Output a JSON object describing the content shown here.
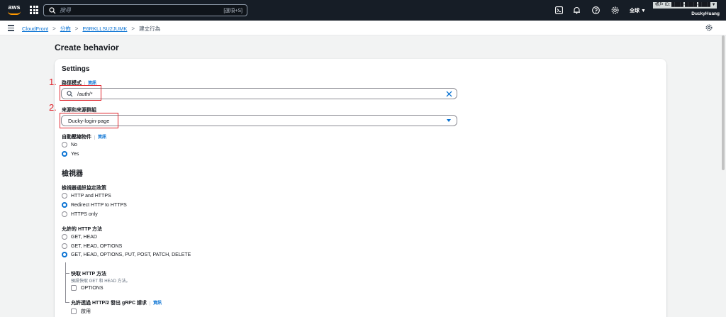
{
  "topbar": {
    "logo_text": "aws",
    "search_placeholder": "搜尋",
    "search_shortcut": "[選項+S]",
    "region": "全球 ▼",
    "account_label": "帳戶 ID: ████-████-████ ▼",
    "username": "DuckyHuang",
    "icons": [
      "cloudshell-icon",
      "bell-icon",
      "help-icon",
      "gear-icon"
    ]
  },
  "breadcrumb": {
    "items": [
      "CloudFront",
      "分佈",
      "E6RKLLSU2JUMK"
    ],
    "current": "建立行為",
    "separator": ">"
  },
  "page": {
    "title": "Create behavior"
  },
  "settings": {
    "heading": "Settings",
    "path_pattern": {
      "label": "路徑模式",
      "info": "資訊",
      "value": "/auth/*"
    },
    "origin": {
      "label": "來源和來源群組",
      "value": "Ducky-login-page"
    },
    "compress": {
      "label": "自動壓縮物件",
      "info": "資訊",
      "options": [
        "No",
        "Yes"
      ],
      "selected": "Yes"
    }
  },
  "viewer": {
    "heading": "檢視器",
    "protocol": {
      "label": "檢視器通訊協定政策",
      "options": [
        "HTTP and HTTPS",
        "Redirect HTTP to HTTPS",
        "HTTPS only"
      ],
      "selected": "Redirect HTTP to HTTPS"
    },
    "methods": {
      "label": "允許的 HTTP 方法",
      "options": [
        "GET, HEAD",
        "GET, HEAD, OPTIONS",
        "GET, HEAD, OPTIONS, PUT, POST, PATCH, DELETE"
      ],
      "selected": "GET, HEAD, OPTIONS, PUT, POST, PATCH, DELETE"
    },
    "cache_methods": {
      "label": "快取 HTTP 方法",
      "description": "預設快取 GET 和 HEAD 方法。",
      "option": "OPTIONS"
    },
    "grpc": {
      "label": "允許透過 HTTP/2 發出 gRPC 請求",
      "info": "資訊",
      "option": "啟用"
    }
  },
  "annotations": {
    "one": "1.",
    "two": "2."
  },
  "colors": {
    "accent": "#0972d3",
    "annotation": "#e0242c",
    "topbar": "#161d26"
  }
}
